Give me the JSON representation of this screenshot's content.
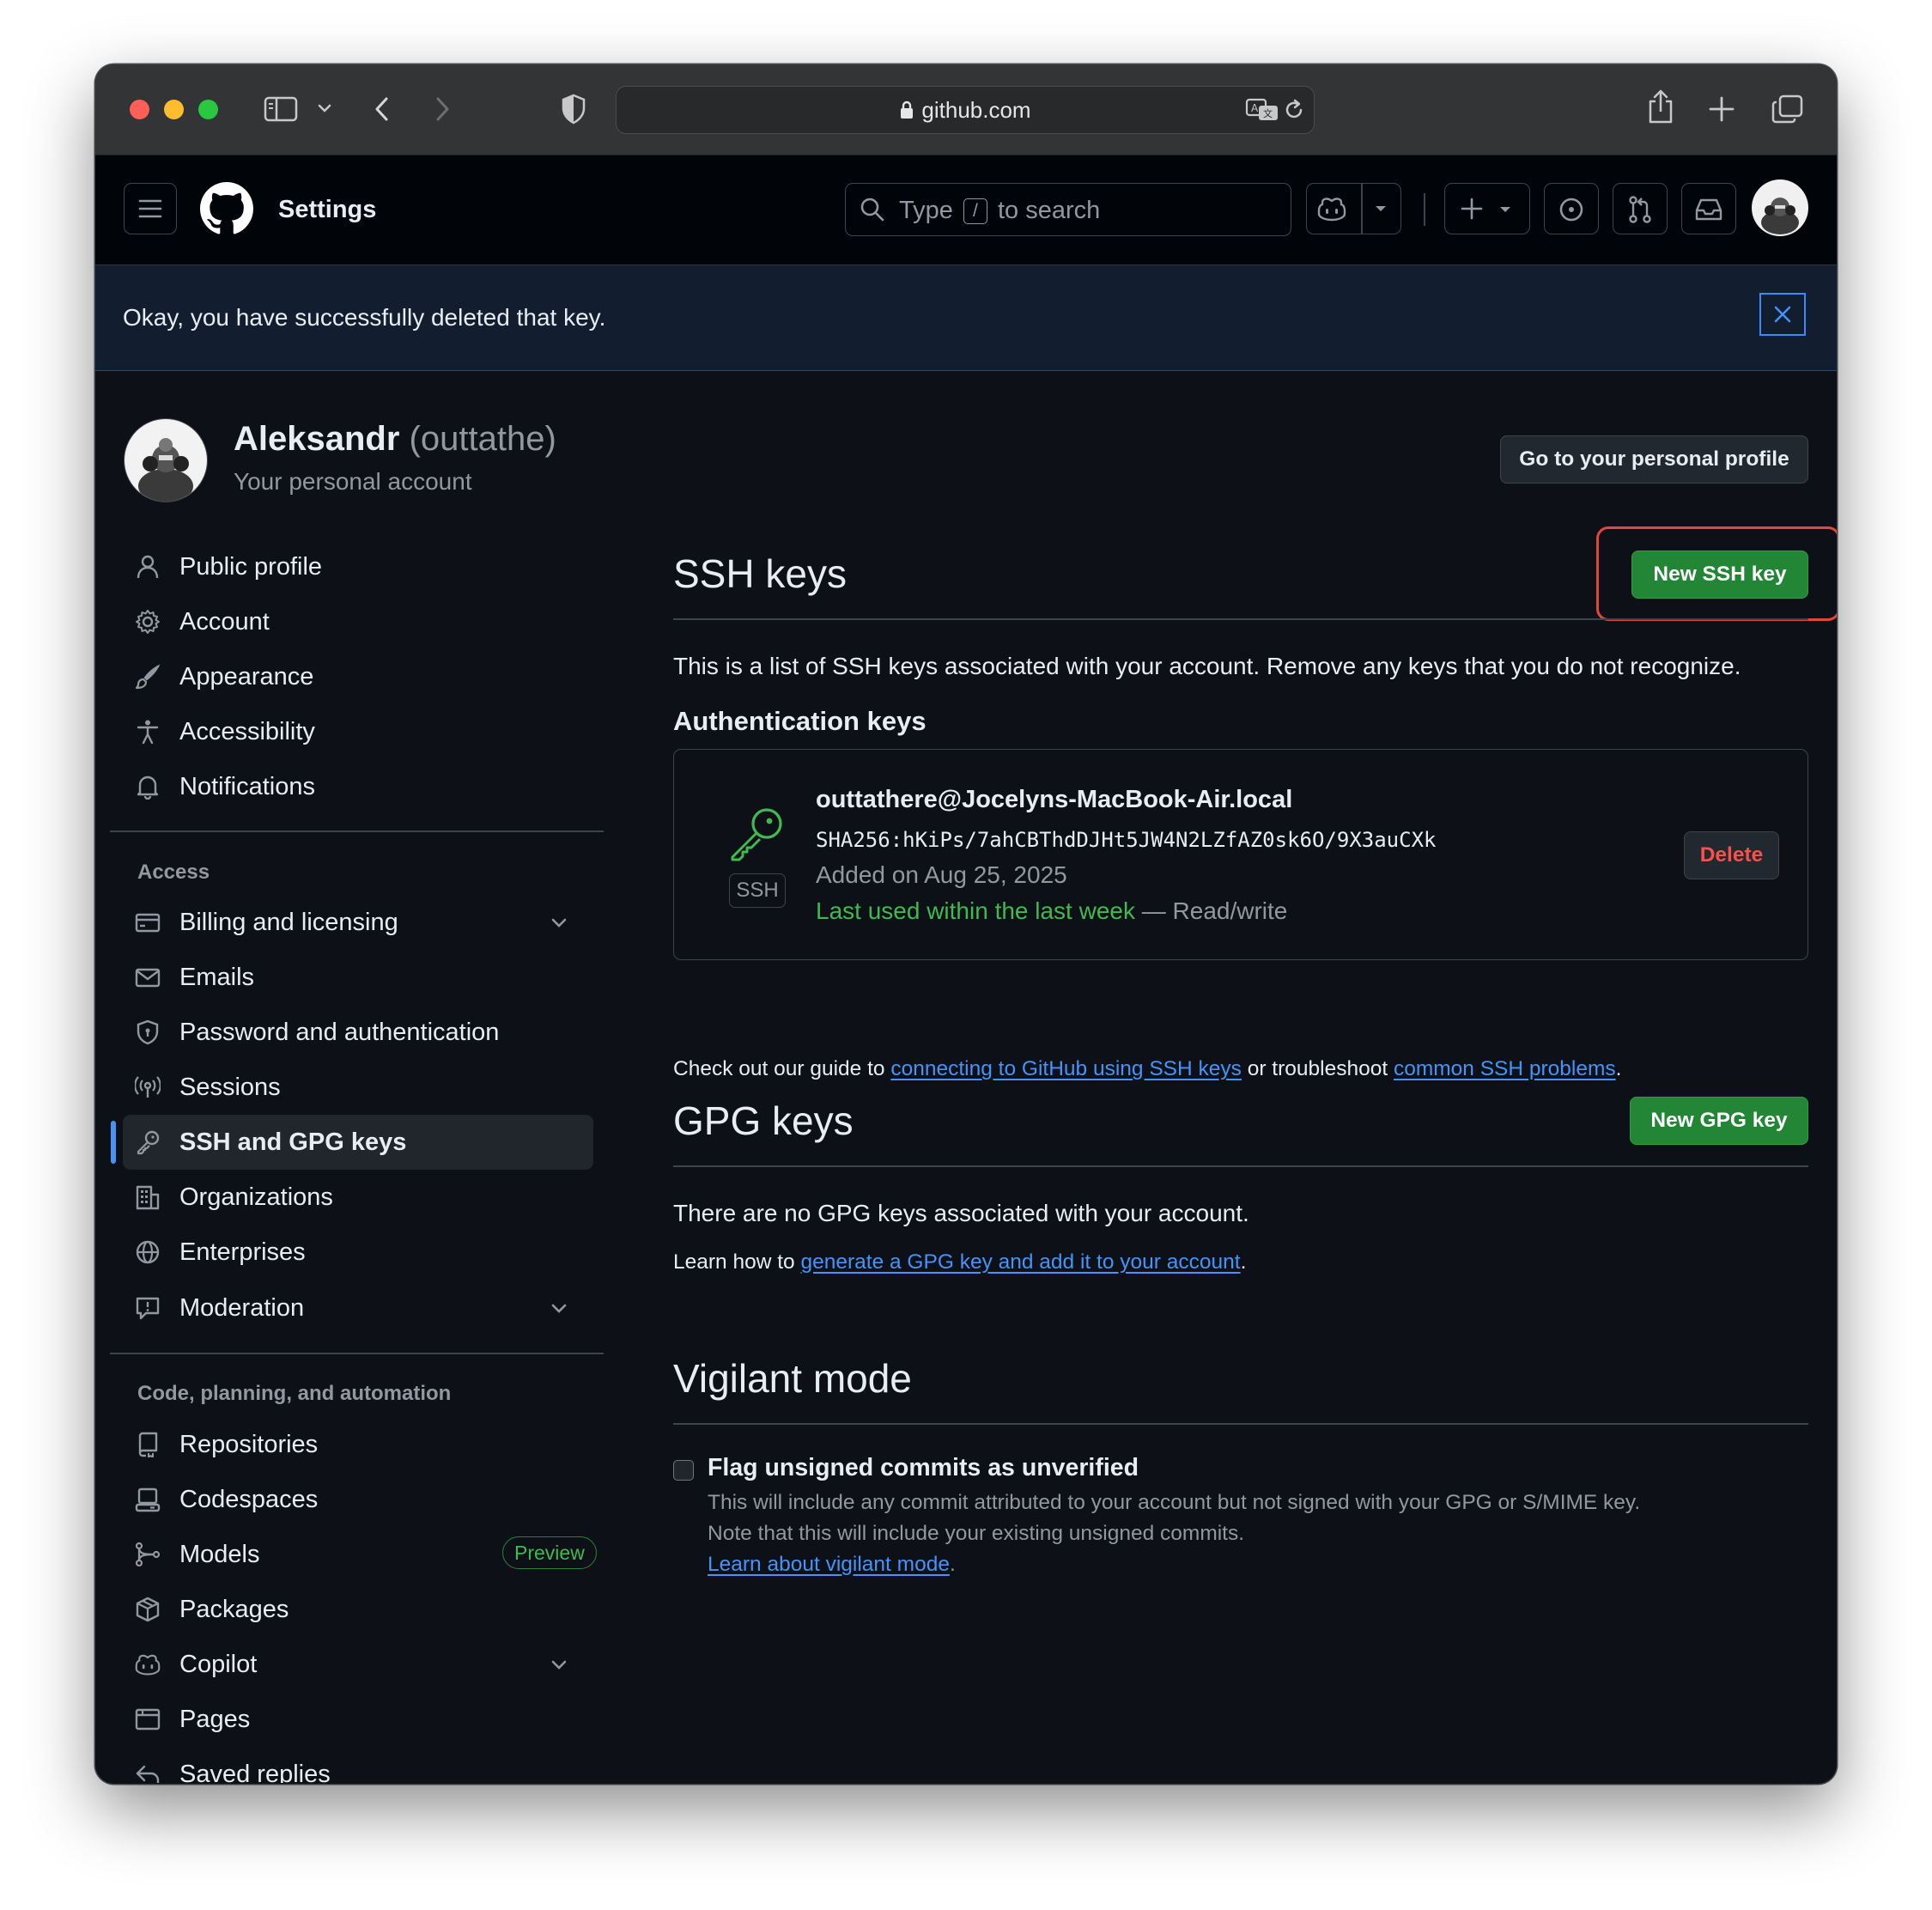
{
  "browser": {
    "url": "github.com"
  },
  "header": {
    "title": "Settings",
    "search_label": "Type",
    "search_slash": "/",
    "search_suffix": "to search"
  },
  "flash": {
    "message": "Okay, you have successfully deleted that key."
  },
  "account": {
    "name": "Aleksandr",
    "handle": "(outtathe)",
    "subtitle": "Your personal account",
    "profile_button": "Go to your personal profile"
  },
  "sidebar": {
    "top_items": [
      {
        "label": "Public profile",
        "icon": "person-icon"
      },
      {
        "label": "Account",
        "icon": "gear-icon"
      },
      {
        "label": "Appearance",
        "icon": "paintbrush-icon"
      },
      {
        "label": "Accessibility",
        "icon": "accessibility-icon"
      },
      {
        "label": "Notifications",
        "icon": "bell-icon"
      }
    ],
    "access_heading": "Access",
    "access_items": [
      {
        "label": "Billing and licensing",
        "icon": "credit-card-icon",
        "expandable": true
      },
      {
        "label": "Emails",
        "icon": "mail-icon"
      },
      {
        "label": "Password and authentication",
        "icon": "shield-lock-icon"
      },
      {
        "label": "Sessions",
        "icon": "broadcast-icon"
      },
      {
        "label": "SSH and GPG keys",
        "icon": "key-icon",
        "active": true
      },
      {
        "label": "Organizations",
        "icon": "organization-icon"
      },
      {
        "label": "Enterprises",
        "icon": "globe-icon"
      },
      {
        "label": "Moderation",
        "icon": "report-icon",
        "expandable": true
      }
    ],
    "code_heading": "Code, planning, and automation",
    "code_items": [
      {
        "label": "Repositories",
        "icon": "repo-icon"
      },
      {
        "label": "Codespaces",
        "icon": "codespaces-icon"
      },
      {
        "label": "Models",
        "icon": "models-icon",
        "badge": "Preview"
      },
      {
        "label": "Packages",
        "icon": "package-icon"
      },
      {
        "label": "Copilot",
        "icon": "copilot-icon",
        "expandable": true
      },
      {
        "label": "Pages",
        "icon": "browser-icon"
      },
      {
        "label": "Saved replies",
        "icon": "reply-icon"
      }
    ]
  },
  "ssh": {
    "title": "SSH keys",
    "new_button": "New SSH key",
    "description": "This is a list of SSH keys associated with your account. Remove any keys that you do not recognize.",
    "auth_heading": "Authentication keys",
    "key": {
      "badge": "SSH",
      "title": "outtathere@Jocelyns-MacBook-Air.local",
      "fingerprint": "SHA256:hKiPs/7ahCBThdDJHt5JW4N2LZfAZ0sk6O/9X3auCXk",
      "added": "Added on Aug 25, 2025",
      "last_used": "Last used within the last week",
      "access": "— Read/write",
      "delete_button": "Delete"
    },
    "guide_prefix": "Check out our guide to",
    "guide_link": "connecting to GitHub using SSH keys",
    "guide_middle": "or troubleshoot",
    "guide_link2": "common SSH problems",
    "guide_suffix": "."
  },
  "gpg": {
    "title": "GPG keys",
    "new_button": "New GPG key",
    "empty": "There are no GPG keys associated with your account.",
    "learn_prefix": "Learn how to",
    "learn_link": "generate a GPG key and add it to your account",
    "learn_suffix": "."
  },
  "vigilant": {
    "title": "Vigilant mode",
    "checkbox_label": "Flag unsigned commits as unverified",
    "checked": false,
    "desc1": "This will include any commit attributed to your account but not signed with your GPG or S/MIME key.",
    "desc2": "Note that this will include your existing unsigned commits.",
    "link": "Learn about vigilant mode",
    "link_suffix": "."
  },
  "colors": {
    "background": "#0d1117",
    "header": "#010409",
    "accent_blue": "#4493f8",
    "green_button": "#238636",
    "danger": "#f85149",
    "success_text": "#3fb950",
    "highlight": "#e5453a"
  }
}
